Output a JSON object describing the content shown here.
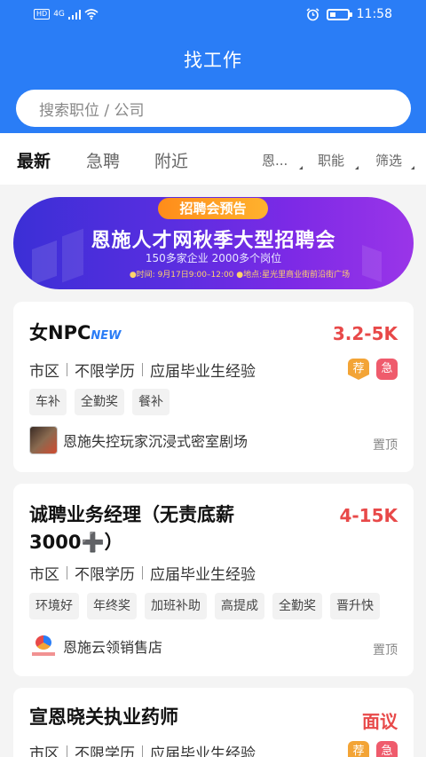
{
  "status_bar": {
    "hd": "HD",
    "net": "4G",
    "time": "11:58"
  },
  "header": {
    "title": "找工作",
    "search_placeholder": "搜索职位 / 公司"
  },
  "tabs": [
    {
      "label": "最新",
      "active": true
    },
    {
      "label": "急聘",
      "active": false
    },
    {
      "label": "附近",
      "active": false
    }
  ],
  "filters": [
    {
      "label": "恩..."
    },
    {
      "label": "职能"
    },
    {
      "label": "筛选"
    }
  ],
  "banner": {
    "tag": "招聘会预告",
    "title": "恩施人才网秋季大型招聘会",
    "subtitle": "150多家企业   2000多个岗位",
    "info": "●时间: 9月17日9:00–12:00   ●地点:星光里商业街前沿街广场"
  },
  "jobs": [
    {
      "title": "女NPC",
      "new_label": "NEW",
      "salary": "3.2-5K",
      "location": "市区",
      "education": "不限学历",
      "experience": "应届毕业生经验",
      "badges": [
        "荐",
        "急"
      ],
      "tags": [
        "车补",
        "全勤奖",
        "餐补"
      ],
      "company": "恩施失控玩家沉浸式密室剧场",
      "pin_label": "置顶"
    },
    {
      "title_line1": "诚聘业务经理（无责底薪",
      "title_line2": "3000➕）",
      "salary": "4-15K",
      "location": "市区",
      "education": "不限学历",
      "experience": "应届毕业生经验",
      "tags": [
        "环境好",
        "年终奖",
        "加班补助",
        "高提成",
        "全勤奖",
        "晋升快"
      ],
      "company": "恩施云领销售店",
      "pin_label": "置顶"
    },
    {
      "title": "宣恩晓关执业药师",
      "salary": "面议",
      "location": "市区",
      "education": "不限学历",
      "experience": "应届毕业生经验",
      "badges": [
        "荐",
        "急"
      ]
    }
  ],
  "colors": {
    "primary": "#2a7df6",
    "salary": "#e84949",
    "badge_rec": "#f3a436",
    "badge_urgent": "#ef5b6c"
  }
}
